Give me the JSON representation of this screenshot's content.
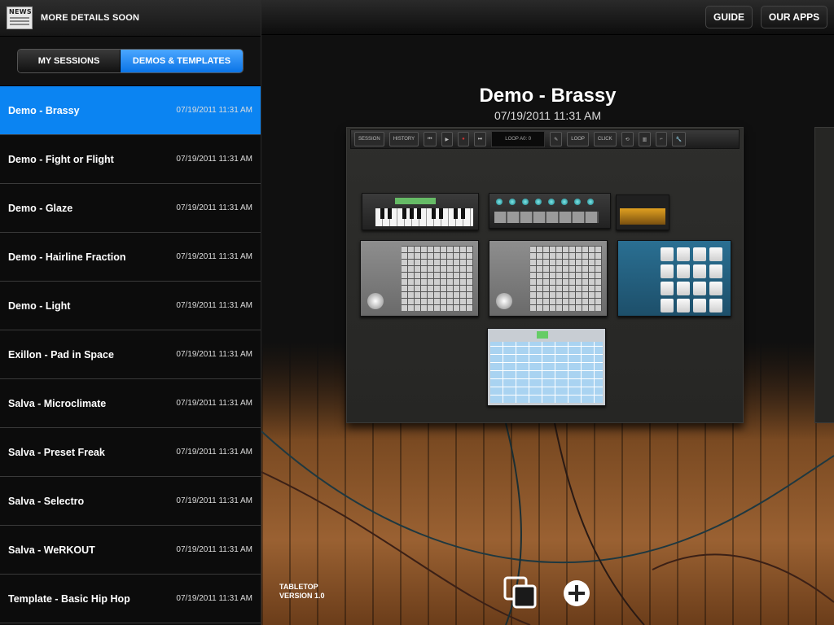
{
  "news": {
    "label": "MORE DETAILS SOON",
    "icon": "newspaper-icon",
    "icon_text": "NEWS"
  },
  "segments": [
    {
      "label": "MY SESSIONS",
      "selected": false
    },
    {
      "label": "DEMOS & TEMPLATES",
      "selected": true
    }
  ],
  "sessions": [
    {
      "name": "Demo - Brassy",
      "date": "07/19/2011 11:31 AM",
      "selected": true
    },
    {
      "name": "Demo - Fight or Flight",
      "date": "07/19/2011 11:31 AM"
    },
    {
      "name": "Demo - Glaze",
      "date": "07/19/2011 11:31 AM"
    },
    {
      "name": "Demo - Hairline Fraction",
      "date": "07/19/2011 11:31 AM"
    },
    {
      "name": "Demo - Light",
      "date": "07/19/2011 11:31 AM"
    },
    {
      "name": "Exillon - Pad in Space",
      "date": "07/19/2011 11:31 AM"
    },
    {
      "name": "Salva - Microclimate",
      "date": "07/19/2011 11:31 AM"
    },
    {
      "name": "Salva - Preset Freak",
      "date": "07/19/2011 11:31 AM"
    },
    {
      "name": "Salva - Selectro",
      "date": "07/19/2011 11:31 AM"
    },
    {
      "name": "Salva - WeRKOUT",
      "date": "07/19/2011 11:31 AM"
    },
    {
      "name": "Template - Basic Hip Hop",
      "date": "07/19/2011 11:31 AM"
    }
  ],
  "topbar": {
    "guide_label": "GUIDE",
    "apps_label": "OUR APPS"
  },
  "preview": {
    "title": "Demo - Brassy",
    "date": "07/19/2011 11:31 AM",
    "transport": {
      "session": "SESSION",
      "history": "HISTORY",
      "loop_display": "LOOP A0: 0",
      "loop": "LOOP",
      "click": "CLICK"
    }
  },
  "footer": {
    "app_name": "TABLETOP",
    "version": "VERSION 1.0"
  },
  "colors": {
    "accent": "#0b84f2",
    "segment_selected": "#1a8cf0"
  }
}
